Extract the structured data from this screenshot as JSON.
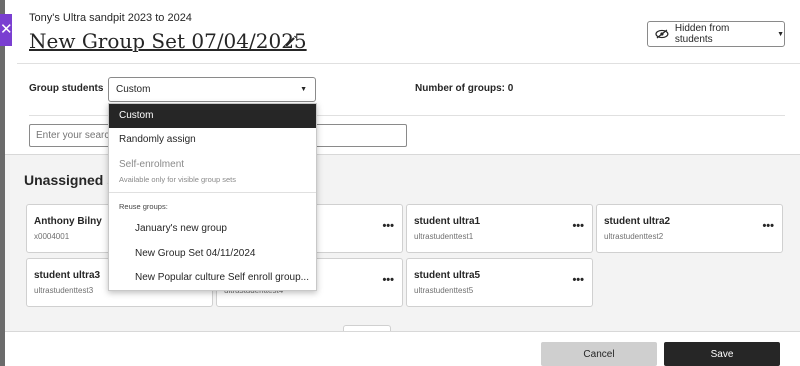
{
  "header": {
    "course_name": "Tony's Ultra sandpit 2023 to 2024",
    "title": "New Group Set 07/04/2025",
    "visibility_button": "Hidden from students"
  },
  "group_students": {
    "label": "Group students",
    "selected": "Custom",
    "number_of_groups_label": "Number of groups: 0"
  },
  "search": {
    "placeholder": "Enter your search"
  },
  "unassigned": {
    "title": "Unassigned students",
    "students": [
      {
        "name": "Anthony Bilny",
        "username": "x0004001"
      },
      {
        "name": "",
        "username": ""
      },
      {
        "name": "student ultra1",
        "username": "ultrastudenttest1"
      },
      {
        "name": "student ultra2",
        "username": "ultrastudenttest2"
      },
      {
        "name": "student ultra3",
        "username": "ultrastudenttest3"
      },
      {
        "name": "",
        "username": "ultrastudenttest4"
      },
      {
        "name": "student ultra5",
        "username": "ultrastudenttest5"
      }
    ]
  },
  "dropdown": {
    "options": [
      {
        "label": "Custom",
        "selected": true
      },
      {
        "label": "Randomly assign"
      },
      {
        "label": "Self-enrolment",
        "disabled": true,
        "note": "Available only for visible group sets"
      }
    ],
    "reuse_heading": "Reuse groups:",
    "reuse_options": [
      "January's new group",
      "New Group Set 04/11/2024",
      "New Popular culture Self enroll group..."
    ]
  },
  "footer": {
    "cancel": "Cancel",
    "save": "Save"
  },
  "icons": {
    "close": "close-icon",
    "edit": "pencil-icon",
    "hidden": "eye-slash-icon",
    "more": "more-options-icon"
  },
  "colors": {
    "accent": "#7a3fd1",
    "primary_button": "#262626",
    "secondary_button": "#cfcfcf"
  }
}
